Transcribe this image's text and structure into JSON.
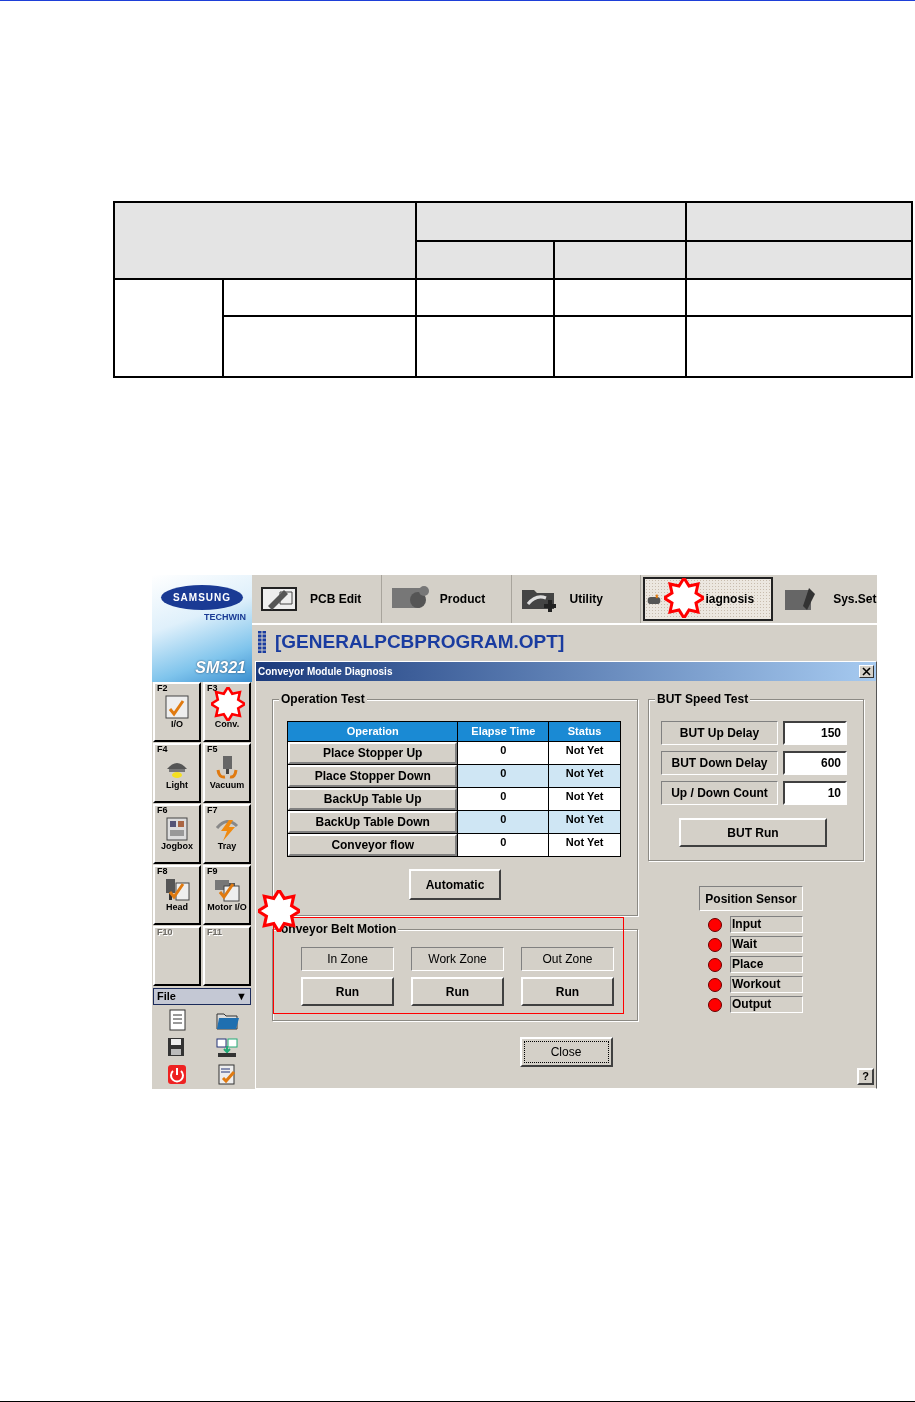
{
  "app": {
    "logo": {
      "brand": "SAMSUNG",
      "sub": "TECHWIN",
      "model": "SM321"
    },
    "function_keys": [
      {
        "key": "F2",
        "label": "I/O",
        "disabled": false
      },
      {
        "key": "F3",
        "label": "Conv.",
        "disabled": false
      },
      {
        "key": "F4",
        "label": "Light",
        "disabled": false
      },
      {
        "key": "F5",
        "label": "Vacuum",
        "disabled": false
      },
      {
        "key": "F6",
        "label": "Jogbox",
        "disabled": false
      },
      {
        "key": "F7",
        "label": "Tray",
        "disabled": false
      },
      {
        "key": "F8",
        "label": "Head",
        "disabled": false
      },
      {
        "key": "F9",
        "label": "Motor I/O",
        "disabled": false
      },
      {
        "key": "F10",
        "disabled": true
      },
      {
        "key": "F11",
        "disabled": true
      }
    ],
    "file_menu": {
      "label": "File",
      "arrow": "▼"
    },
    "toolbar": [
      {
        "label": "PCB Edit",
        "selected": false
      },
      {
        "label": "Product",
        "selected": false
      },
      {
        "label": "Utility",
        "selected": false
      },
      {
        "label": "iagnosis",
        "selected": true
      },
      {
        "label": "Sys.Set",
        "selected": false
      }
    ],
    "program_title": "[GENERALPCBPROGRAM.OPT]",
    "dialog": {
      "title": "Conveyor Module Diagnosis",
      "operation_test": {
        "title": "Operation Test",
        "columns": [
          "Operation",
          "Elapse Time",
          "Status"
        ],
        "rows": [
          {
            "operation": "Place Stopper Up",
            "elapse_time": "0",
            "status": "Not Yet"
          },
          {
            "operation": "Place Stopper Down",
            "elapse_time": "0",
            "status": "Not Yet"
          },
          {
            "operation": "BackUp Table Up",
            "elapse_time": "0",
            "status": "Not Yet"
          },
          {
            "operation": "BackUp Table Down",
            "elapse_time": "0",
            "status": "Not Yet"
          },
          {
            "operation": "Conveyor flow",
            "elapse_time": "0",
            "status": "Not Yet"
          }
        ],
        "button": "Automatic"
      },
      "belt_motion": {
        "title": "onveyor Belt Motion",
        "zones": [
          {
            "label": "In Zone",
            "button": "Run"
          },
          {
            "label": "Work Zone",
            "button": "Run"
          },
          {
            "label": "Out Zone",
            "button": "Run"
          }
        ]
      },
      "but_speed_test": {
        "title": "BUT Speed Test",
        "fields": [
          {
            "label": "BUT Up Delay",
            "value": "150"
          },
          {
            "label": "BUT Down Delay",
            "value": "600"
          },
          {
            "label": "Up / Down Count",
            "value": "10"
          }
        ],
        "button": "BUT Run"
      },
      "position_sensor": {
        "title": "Position Sensor",
        "sensors": [
          {
            "label": "Input",
            "color": "#ff0000"
          },
          {
            "label": "Wait",
            "color": "#ff0000"
          },
          {
            "label": "Place",
            "color": "#ff0000"
          },
          {
            "label": "Workout",
            "color": "#ff0000"
          },
          {
            "label": "Output",
            "color": "#ff0000"
          }
        ]
      },
      "close_button": "Close",
      "help": "?"
    }
  },
  "callouts": [
    {
      "kind": "star"
    },
    {
      "kind": "star"
    },
    {
      "kind": "star"
    },
    {
      "kind": "frame"
    }
  ]
}
